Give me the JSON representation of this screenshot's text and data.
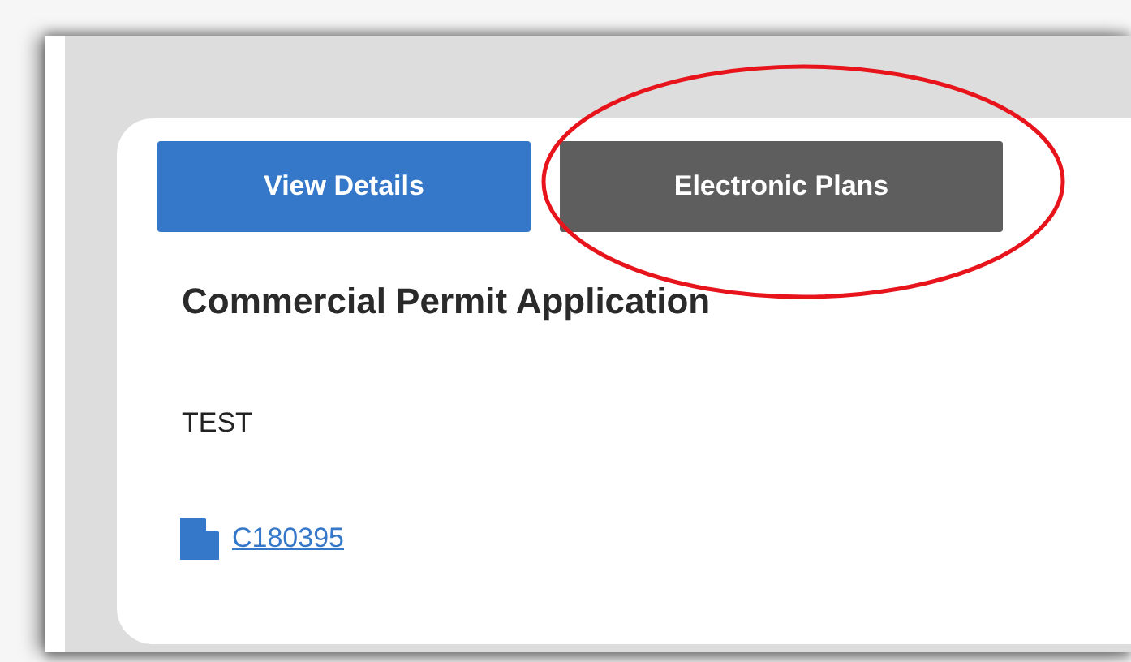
{
  "buttons": [
    {
      "label": "View Details",
      "kind": "primary"
    },
    {
      "label": "Electronic Plans",
      "kind": "secondary"
    }
  ],
  "card": {
    "title": "Commercial Permit Application",
    "description": "TEST",
    "attachment": "C180395"
  },
  "annotation": {
    "kind": "ellipse",
    "color": "#e8141c"
  }
}
